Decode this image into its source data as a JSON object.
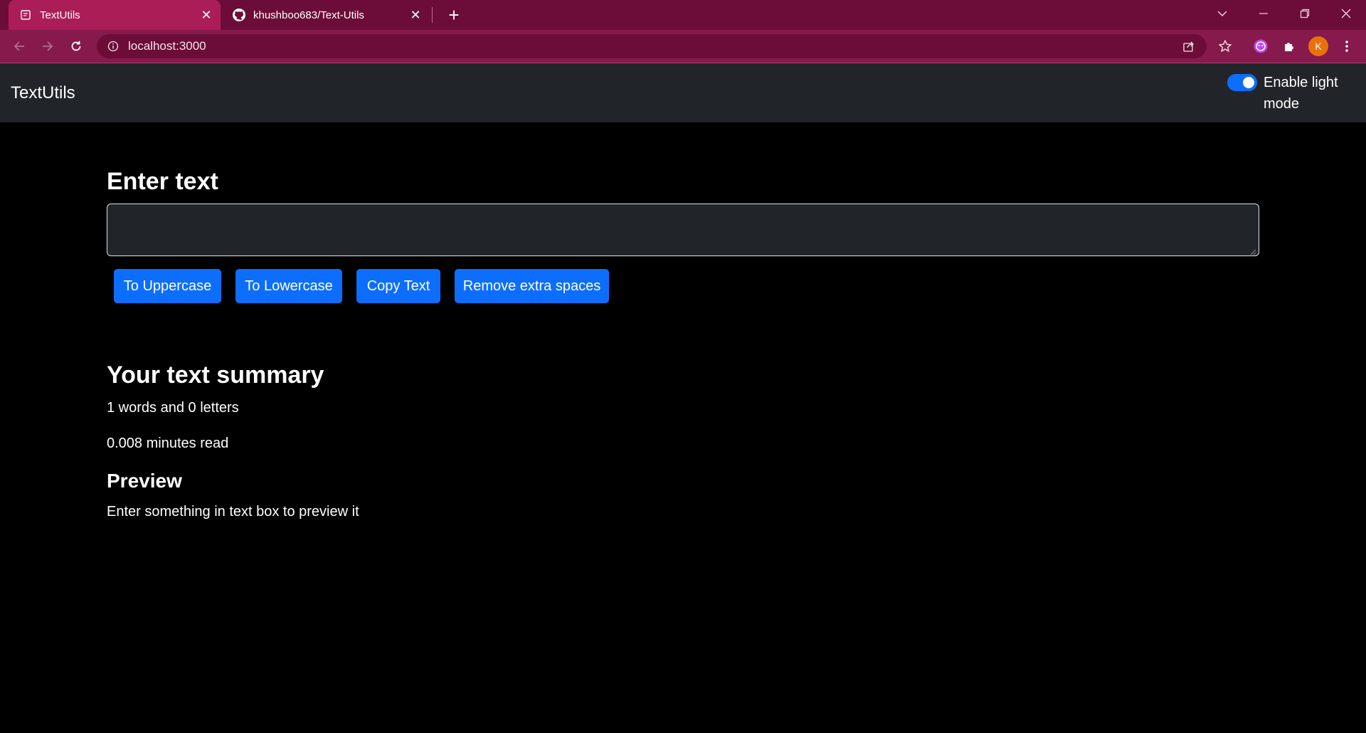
{
  "browser": {
    "tabs": [
      {
        "title": "TextUtils",
        "icon": "document-icon",
        "active": true
      },
      {
        "title": "khushboo683/Text-Utils",
        "icon": "github-icon",
        "active": false
      }
    ],
    "new_tab_label": "+",
    "url": "localhost:3000",
    "profile_initial": "K",
    "colors": {
      "tab_strip": "#6b0d38",
      "active_tab": "#ab1d57",
      "toolbar": "#861a4c",
      "profile": "#e8710a"
    }
  },
  "navbar": {
    "brand": "TextUtils",
    "mode_toggle": {
      "label": "Enable light mode",
      "checked": true
    }
  },
  "main": {
    "heading": "Enter text",
    "textarea_value": "",
    "buttons": [
      "To Uppercase",
      "To Lowercase",
      "Copy Text",
      "Remove extra spaces"
    ]
  },
  "summary": {
    "heading": "Your text summary",
    "counts": "1 words and 0 letters",
    "read_time": "0.008 minutes read",
    "preview_heading": "Preview",
    "preview_text": "Enter something in text box to preview it"
  },
  "theme": {
    "primary": "#0d6efd",
    "navbar_bg": "#212529",
    "page_bg": "#000000",
    "text": "#ffffff"
  }
}
